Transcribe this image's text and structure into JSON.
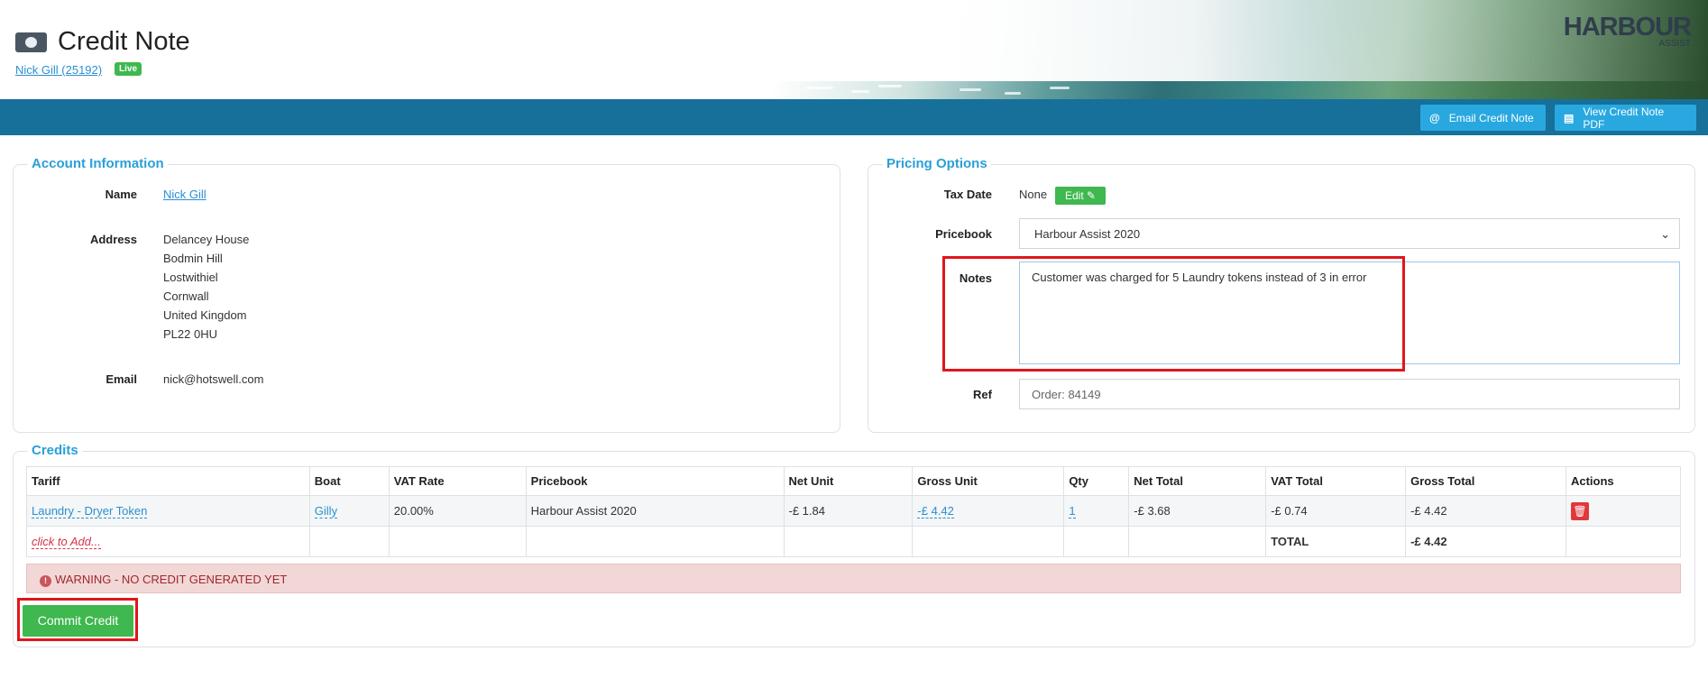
{
  "header": {
    "title": "Credit Note",
    "customer_link": "Nick Gill (25192)",
    "status_badge": "Live",
    "logo_text": "HARBOUR",
    "logo_sub": "ASSIST"
  },
  "toolbar": {
    "email_label": "Email Credit Note",
    "pdf_label": "View Credit Note PDF"
  },
  "account": {
    "legend": "Account Information",
    "name_label": "Name",
    "name_value": "Nick Gill",
    "address_label": "Address",
    "address_lines": [
      "Delancey House",
      "Bodmin Hill",
      "Lostwithiel",
      "Cornwall",
      "United Kingdom",
      "PL22 0HU"
    ],
    "email_label": "Email",
    "email_value": "nick@hotswell.com"
  },
  "pricing": {
    "legend": "Pricing Options",
    "tax_date_label": "Tax Date",
    "tax_date_value": "None",
    "edit_label": "Edit",
    "pricebook_label": "Pricebook",
    "pricebook_value": "Harbour Assist 2020",
    "notes_label": "Notes",
    "notes_value": "Customer was charged for 5 Laundry tokens instead of 3 in error",
    "ref_label": "Ref",
    "ref_placeholder": "Order: 84149"
  },
  "credits": {
    "legend": "Credits",
    "columns": [
      "Tariff",
      "Boat",
      "VAT Rate",
      "Pricebook",
      "Net Unit",
      "Gross Unit",
      "Qty",
      "Net Total",
      "VAT Total",
      "Gross Total",
      "Actions"
    ],
    "row": {
      "tariff": "Laundry - Dryer Token",
      "boat": "Gilly",
      "vat_rate": "20.00%",
      "pricebook": "Harbour Assist 2020",
      "net_unit": "-£ 1.84",
      "gross_unit": "-£ 4.42",
      "qty": "1",
      "net_total": "-£ 3.68",
      "vat_total": "-£ 0.74",
      "gross_total": "-£ 4.42"
    },
    "add_label": "click to Add...",
    "total_label": "TOTAL",
    "total_value": "-£ 4.42",
    "warning": "WARNING - NO CREDIT GENERATED YET",
    "commit_label": "Commit Credit"
  },
  "colors": {
    "accent": "#2a9fd8",
    "toolbar": "#16709a",
    "success": "#3fb84f",
    "danger": "#e0383b",
    "highlight": "#e0161b"
  }
}
